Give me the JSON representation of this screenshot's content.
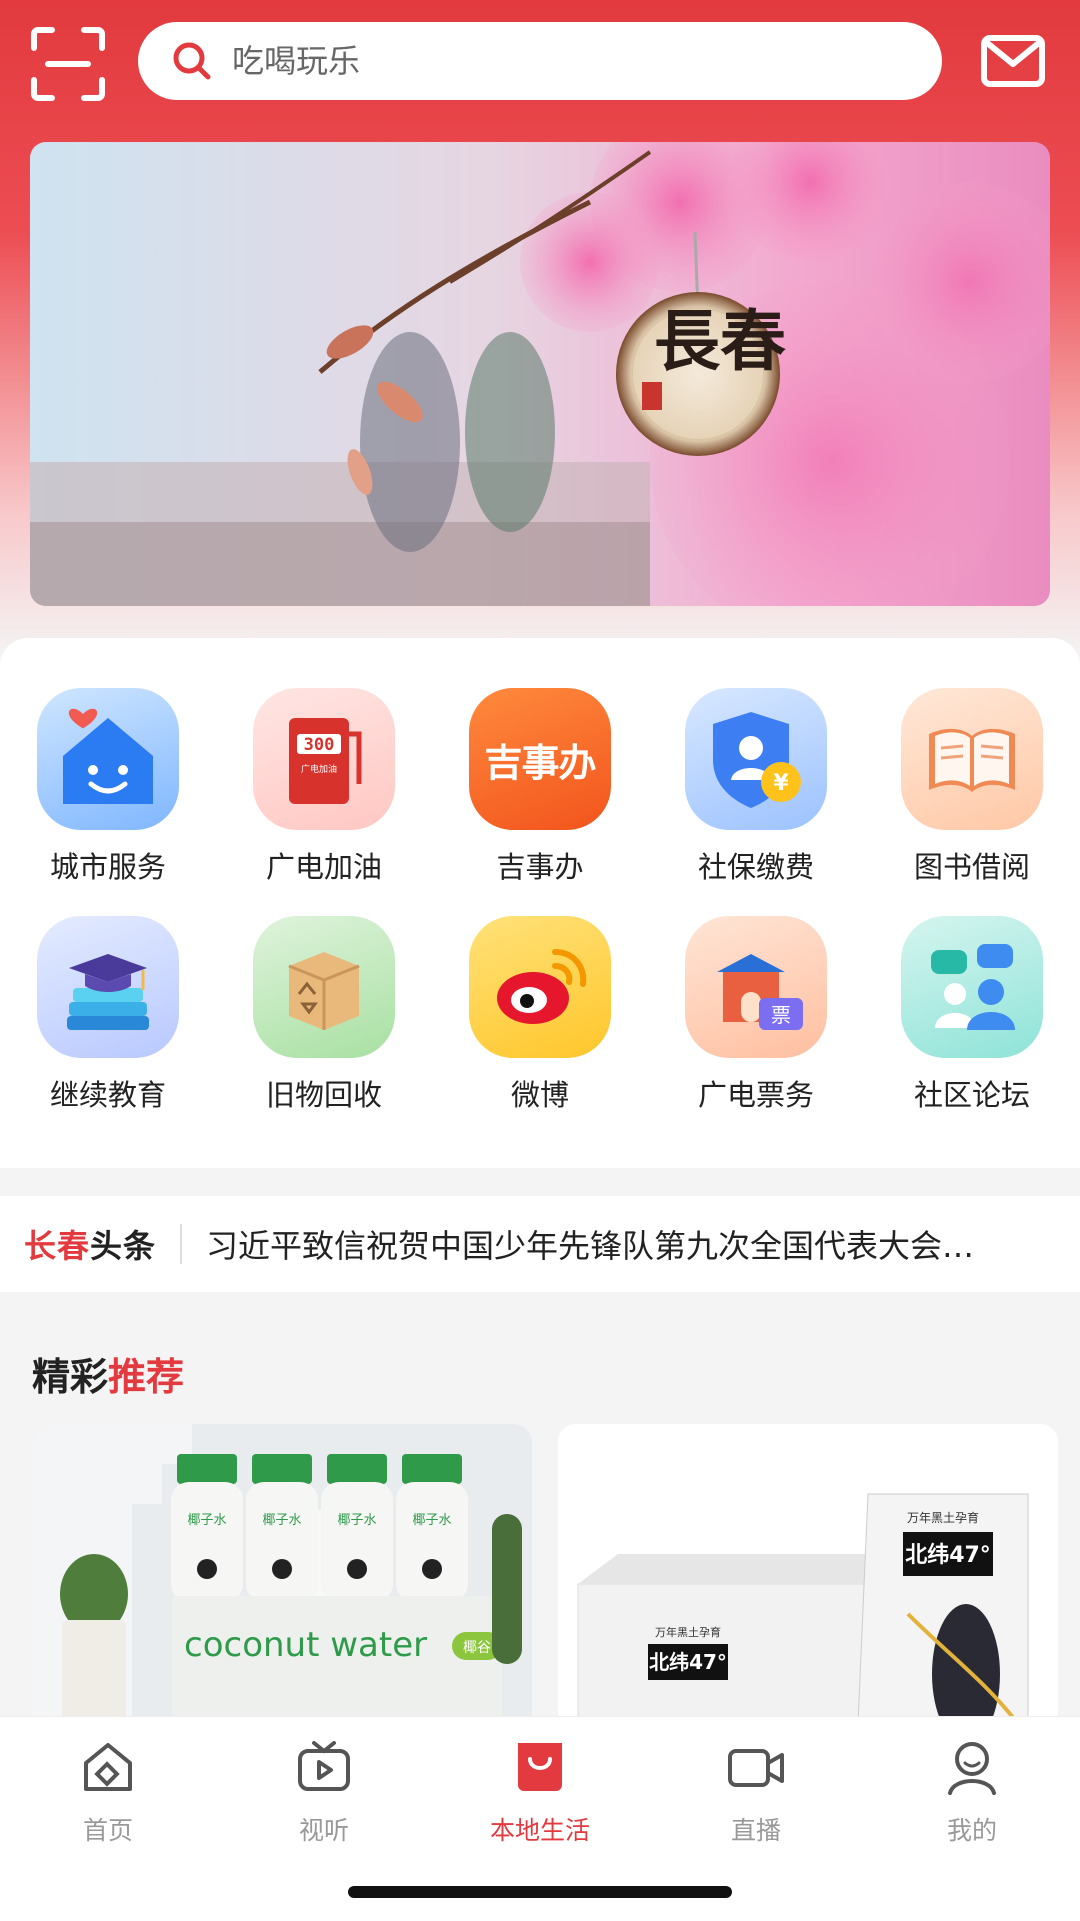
{
  "search": {
    "placeholder": "吃喝玩乐"
  },
  "banner": {
    "seal_text": "長春",
    "stamp_text": "长春"
  },
  "services": [
    {
      "label": "城市服务",
      "icon": "city-house-icon"
    },
    {
      "label": "广电加油",
      "icon": "fuel-pump-icon",
      "badge": "300",
      "sub": "广电加油"
    },
    {
      "label": "吉事办",
      "icon": "jishiban-logo-icon",
      "logo_text": "吉事办"
    },
    {
      "label": "社保缴费",
      "icon": "shield-yen-icon",
      "coin": "¥"
    },
    {
      "label": "图书借阅",
      "icon": "open-book-icon"
    },
    {
      "label": "继续教育",
      "icon": "graduation-cap-books-icon"
    },
    {
      "label": "旧物回收",
      "icon": "recycle-box-icon"
    },
    {
      "label": "微博",
      "icon": "weibo-icon"
    },
    {
      "label": "广电票务",
      "icon": "gate-ticket-icon",
      "ticket_text": "票"
    },
    {
      "label": "社区论坛",
      "icon": "community-chat-icon"
    }
  ],
  "news": {
    "brand_red": "长春",
    "brand_dark": "头条",
    "headline": "习近平致信祝贺中国少年先锋队第九次全国代表大会…"
  },
  "recommend": {
    "title_a": "精彩",
    "title_b": "推荐",
    "cards": [
      {
        "name": "coconut-water",
        "text": "coconut water",
        "bottle_label": "椰子水",
        "tag": "椰谷"
      },
      {
        "name": "beiwei-corn",
        "brand": "北纬47°",
        "tagline": "万年黑土孕育"
      }
    ]
  },
  "tabs": [
    {
      "label": "首页",
      "icon": "home-icon",
      "active": false
    },
    {
      "label": "视听",
      "icon": "tv-play-icon",
      "active": false
    },
    {
      "label": "本地生活",
      "icon": "shopping-bag-icon",
      "active": true
    },
    {
      "label": "直播",
      "icon": "video-camera-icon",
      "active": false
    },
    {
      "label": "我的",
      "icon": "profile-icon",
      "active": false
    }
  ],
  "colors": {
    "accent": "#e23a3e",
    "header": "#e8474c"
  }
}
